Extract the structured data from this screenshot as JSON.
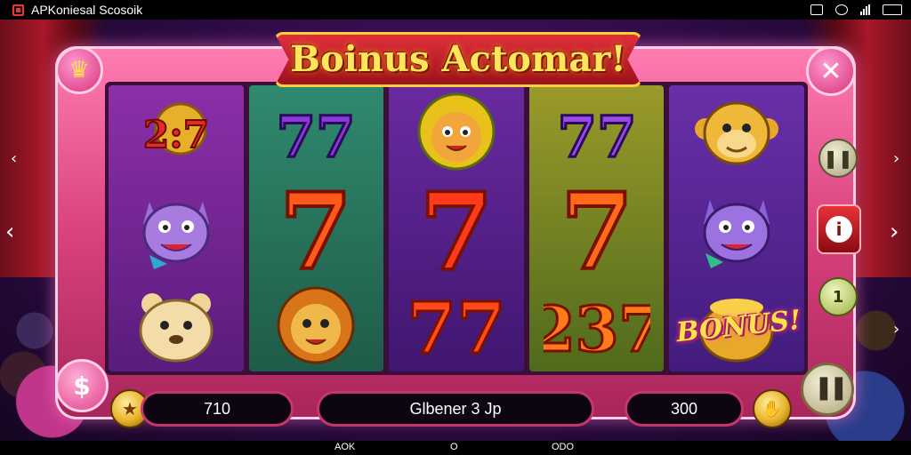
{
  "status_bar": {
    "app_title": "APKoniesal Scosoik",
    "icons": [
      "app-icon",
      "alarm-icon",
      "signal-icon",
      "wifi-icon",
      "battery-icon"
    ]
  },
  "banner": {
    "title": "Boinus Actomar!"
  },
  "reels": [
    [
      "267",
      "wolf",
      "bear"
    ],
    [
      "77",
      "7",
      "lion"
    ],
    [
      "lion",
      "7",
      "77"
    ],
    [
      "77",
      "7",
      "237"
    ],
    [
      "monkey",
      "wolf",
      "bonus-pot"
    ]
  ],
  "symbol_text": {
    "s267": "2:7",
    "s77": "77",
    "s7": "7",
    "s237": "237"
  },
  "bonus_tag": "BONUS!",
  "side_buttons": {
    "top_left": "lion-crest",
    "close": "✕",
    "info": "i",
    "right_side": [
      "pause",
      "stop",
      "coin"
    ]
  },
  "bottom_bar": {
    "left_value": "710",
    "center_value": "Glbener 3 Jp",
    "right_value": "300"
  },
  "nav_bar": {
    "left": "AOK",
    "center": "O",
    "right": "ODO"
  },
  "colors": {
    "frame": "#d9427f",
    "banner": "#c2242e",
    "gold": "#ffe24a"
  }
}
